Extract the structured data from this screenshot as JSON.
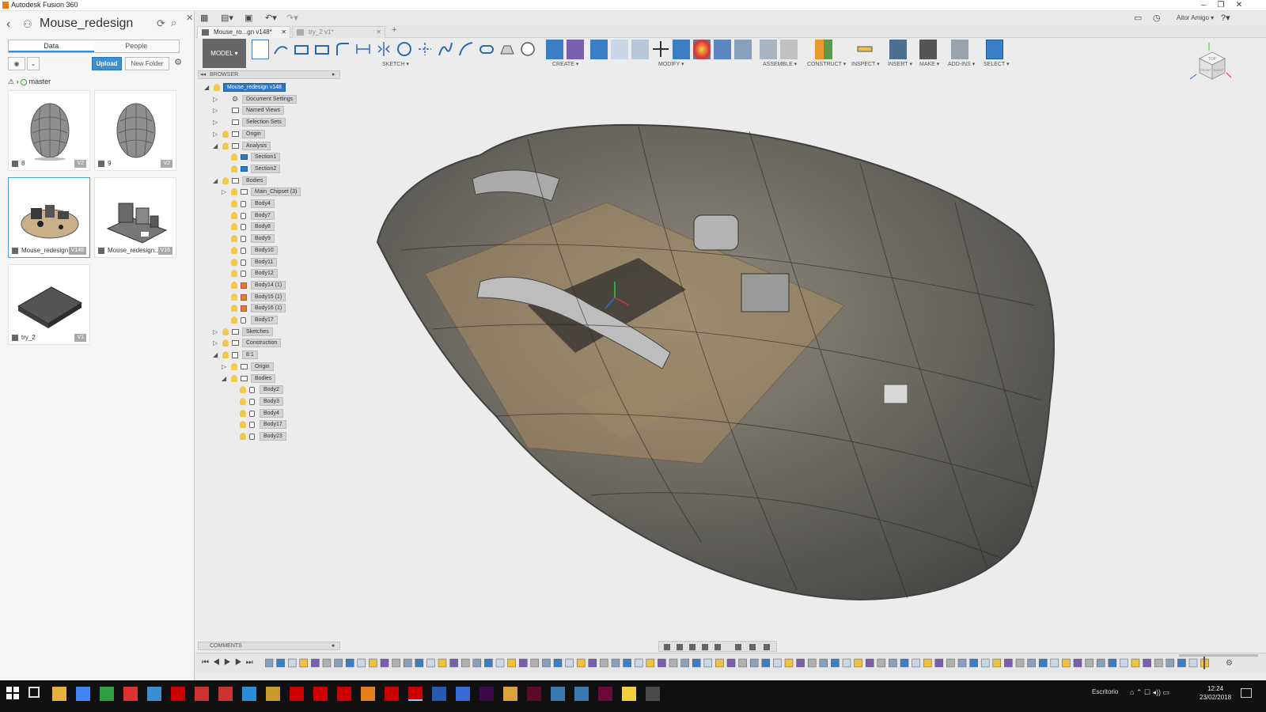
{
  "app": {
    "title": "Autodesk Fusion 360",
    "accent": "#e3801e"
  },
  "data_panel": {
    "project_title": "Mouse_redesign",
    "tabs": [
      "Data",
      "People"
    ],
    "active_tab": "Data",
    "upload_label": "Upload",
    "new_folder_label": "New Folder",
    "branch": "master",
    "files": [
      {
        "name": "8",
        "version": "V2"
      },
      {
        "name": "9",
        "version": "V2"
      },
      {
        "name": "Mouse_redesign",
        "version": "V148"
      },
      {
        "name": "Mouse_redesign...",
        "version": "V16"
      },
      {
        "name": "try_2",
        "version": "V1"
      }
    ]
  },
  "header": {
    "user": "Aitor Amigo ▾"
  },
  "doc_tabs": [
    {
      "label": "Mouse_ro...gn v148*",
      "active": true
    },
    {
      "label": "try_2 v1*",
      "active": false
    }
  ],
  "ribbon": {
    "workspace": "MODEL ▾",
    "groups": [
      "SKETCH ▾",
      "CREATE ▾",
      "MODIFY ▾",
      "ASSEMBLE ▾",
      "CONSTRUCT ▾",
      "INSPECT ▾",
      "INSERT ▾",
      "MAKE ▾",
      "ADD-INS ▾",
      "SELECT ▾"
    ]
  },
  "browser": {
    "title": "BROWSER",
    "root": "Mouse_redesign v148",
    "nodes": [
      "Document Settings",
      "Named Views",
      "Selection Sets",
      "Origin",
      "Analysis",
      "Section1",
      "Section2",
      "Bodies",
      "Main_Chipset (3)",
      "Body4",
      "Body7",
      "Body8",
      "Body9",
      "Body10",
      "Body11",
      "Body12",
      "Body14 (1)",
      "Body15 (1)",
      "Body16 (1)",
      "Body17",
      "Sketches",
      "Construction",
      "8:1",
      "Origin",
      "Bodies",
      "Body2",
      "Body3",
      "Body4",
      "Body17",
      "Body23"
    ]
  },
  "comments": {
    "title": "COMMENTS"
  },
  "viewcube": {
    "top": "TOP",
    "front": "FRONT",
    "right": "RIGHT"
  },
  "taskbar": {
    "desktop_label": "Escritorio",
    "time": "12:24",
    "date": "23/02/2018"
  }
}
